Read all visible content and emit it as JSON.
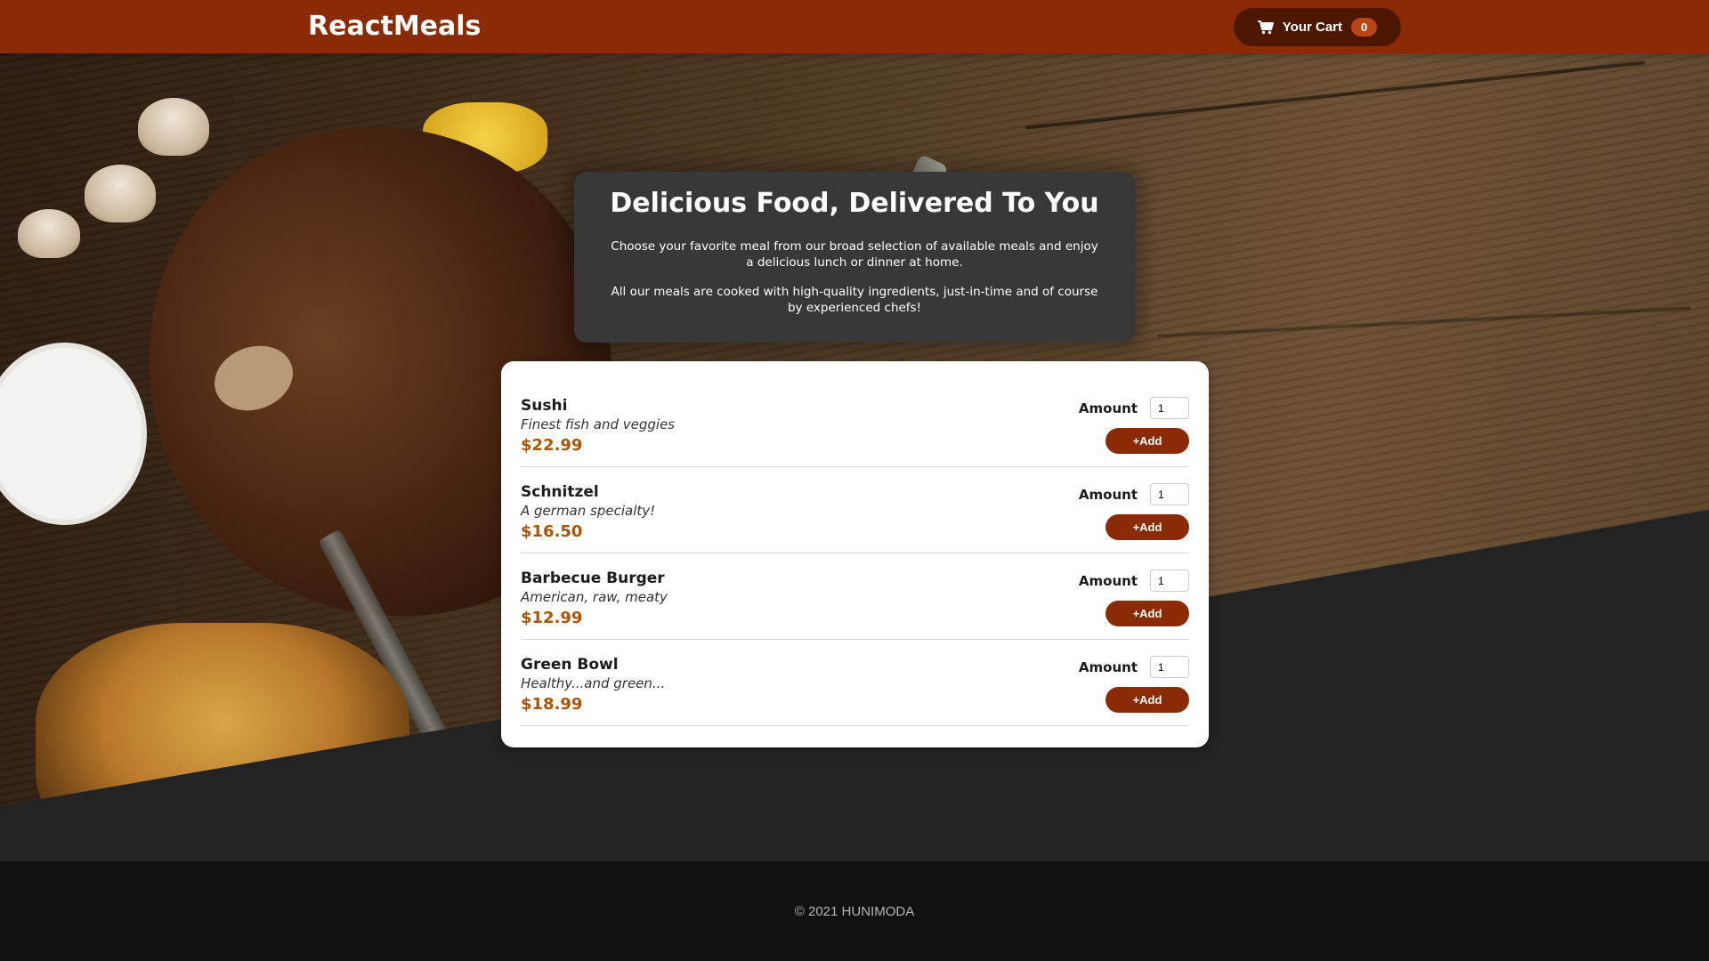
{
  "header": {
    "logo": "ReactMeals",
    "cart_label": "Your Cart",
    "cart_count": "0",
    "cart_icon": "shopping-cart-icon"
  },
  "summary": {
    "title": "Delicious Food, Delivered To You",
    "paragraph_1": "Choose your favorite meal from our broad selection of available meals and enjoy a delicious lunch or dinner at home.",
    "paragraph_2": "All our meals are cooked with high-quality ingredients, just-in-time and of course by experienced chefs!"
  },
  "meals": {
    "amount_label": "Amount",
    "add_label": "+Add",
    "items": [
      {
        "name": "Sushi",
        "description": "Finest fish and veggies",
        "price": "$22.99",
        "amount": "1"
      },
      {
        "name": "Schnitzel",
        "description": "A german specialty!",
        "price": "$16.50",
        "amount": "1"
      },
      {
        "name": "Barbecue Burger",
        "description": "American, raw, meaty",
        "price": "$12.99",
        "amount": "1"
      },
      {
        "name": "Green Bowl",
        "description": "Healthy...and green...",
        "price": "$18.99",
        "amount": "1"
      }
    ]
  },
  "footer": {
    "copyright": "© 2021 HUNIMODA"
  },
  "colors": {
    "header_bg": "#8a2b06",
    "cart_bg": "#4d1601",
    "badge_bg": "#b94517",
    "price": "#ad5502",
    "summary_bg": "#383838",
    "footer_bg": "#111111"
  }
}
